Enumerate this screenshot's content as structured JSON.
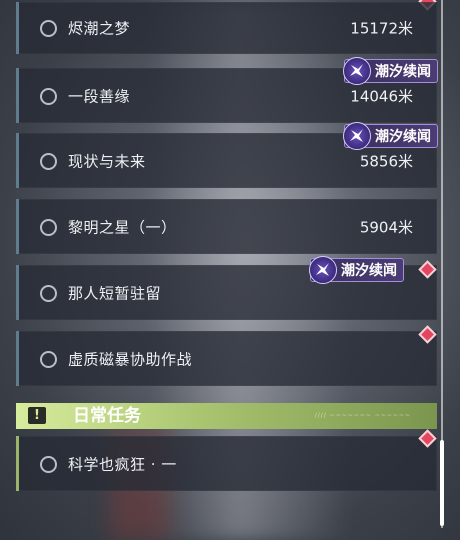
{
  "quests": [
    {
      "label": "烬潮之梦",
      "distance": "15172米"
    },
    {
      "label": "一段善缘",
      "distance": "14046米"
    },
    {
      "label": "现状与未来",
      "distance": "5856米"
    },
    {
      "label": "黎明之星（一）",
      "distance": "5904米"
    },
    {
      "label": "那人短暂驻留",
      "distance": ""
    },
    {
      "label": "虚质磁暴协助作战",
      "distance": ""
    }
  ],
  "tag_label": "潮汐续闻",
  "daily_section": {
    "title": "日常任务",
    "icon": "!",
    "deco_text": "////  ~~~~~~~  ~~~~~~"
  },
  "daily_quests": [
    {
      "label": "科学也疯狂 · 一"
    }
  ],
  "colors": {
    "tag_bg": "#3a2f5e",
    "marker": "#e4455f",
    "daily_header": "#c9e08a"
  }
}
